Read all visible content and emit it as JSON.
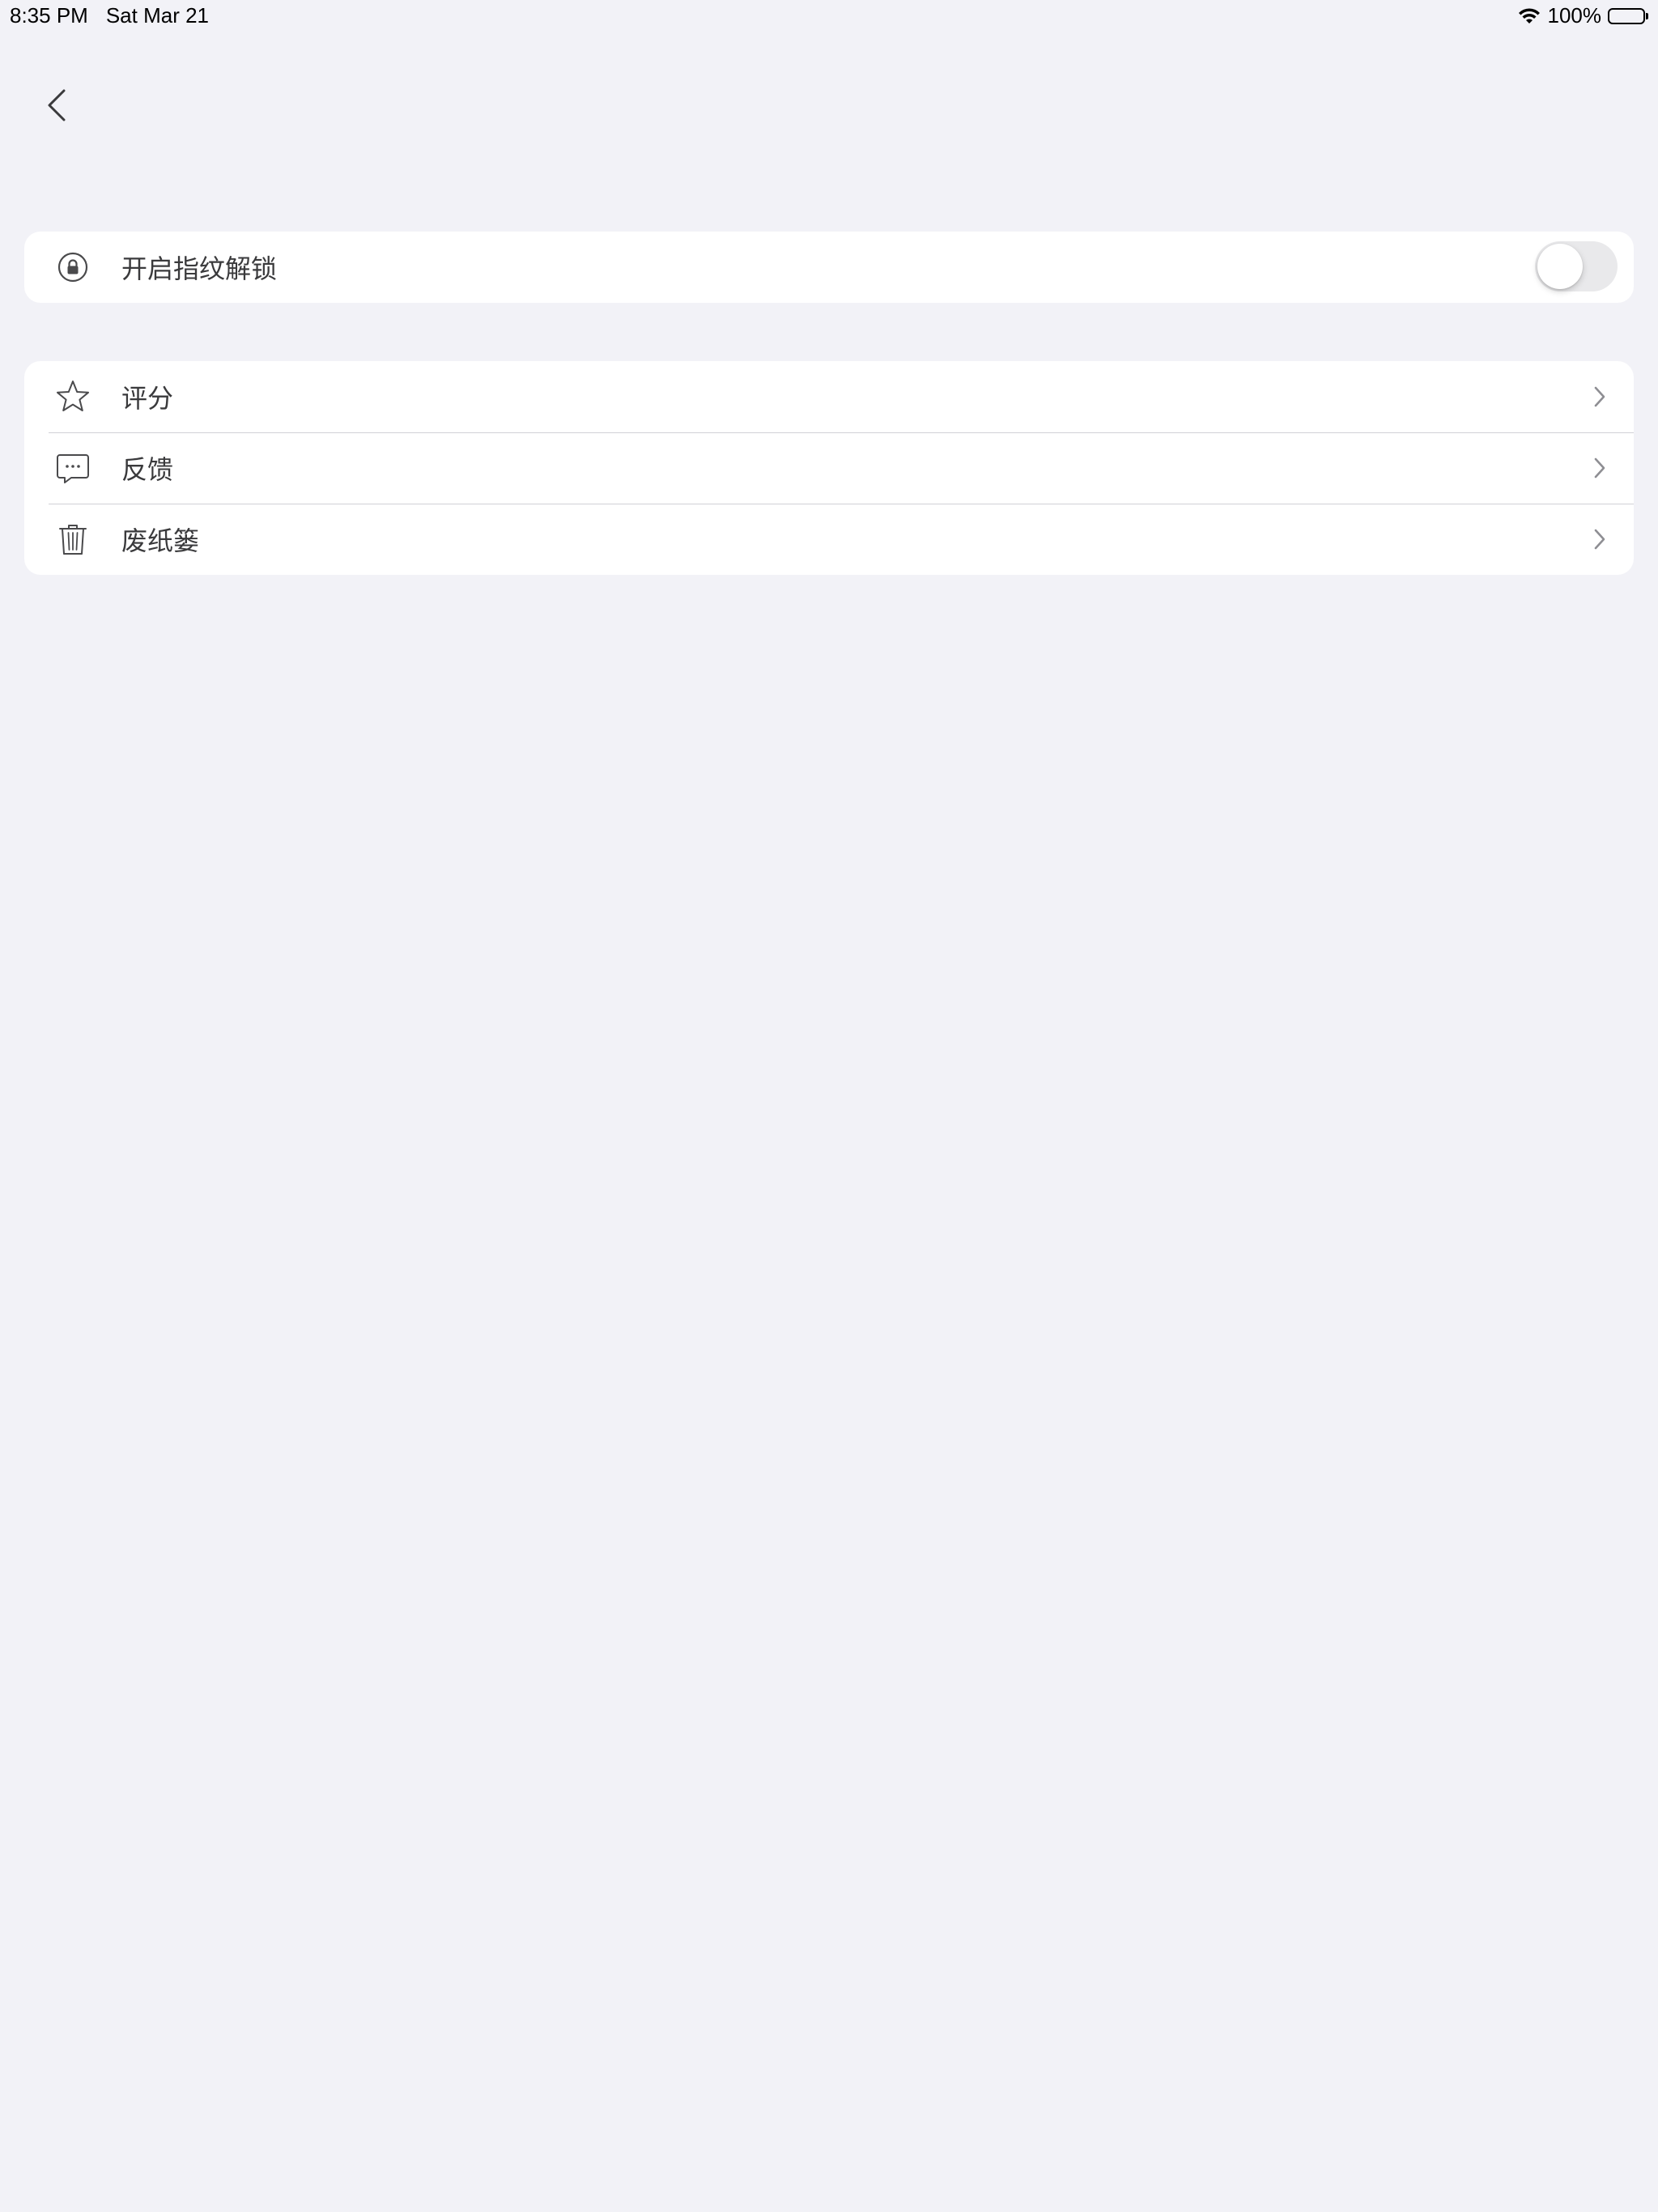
{
  "status_bar": {
    "time": "8:35 PM",
    "date": "Sat Mar 21",
    "battery_text": "100%",
    "battery_level": 1.0
  },
  "nav": {
    "back_icon": "chevron-left-icon"
  },
  "security_group": {
    "items": [
      {
        "icon": "lock-circle-icon",
        "label": "开启指纹解锁",
        "toggle_on": false
      }
    ]
  },
  "menu_group": {
    "items": [
      {
        "icon": "star-icon",
        "label": "评分"
      },
      {
        "icon": "chat-bubble-icon",
        "label": "反馈"
      },
      {
        "icon": "trash-icon",
        "label": "废纸篓"
      }
    ]
  },
  "colors": {
    "background": "#f2f2f7",
    "card": "#ffffff",
    "label": "#3a3a3c",
    "icon": "#4a4a4c",
    "chevron": "#8e8e93",
    "toggle_off": "#e9e9eb"
  }
}
